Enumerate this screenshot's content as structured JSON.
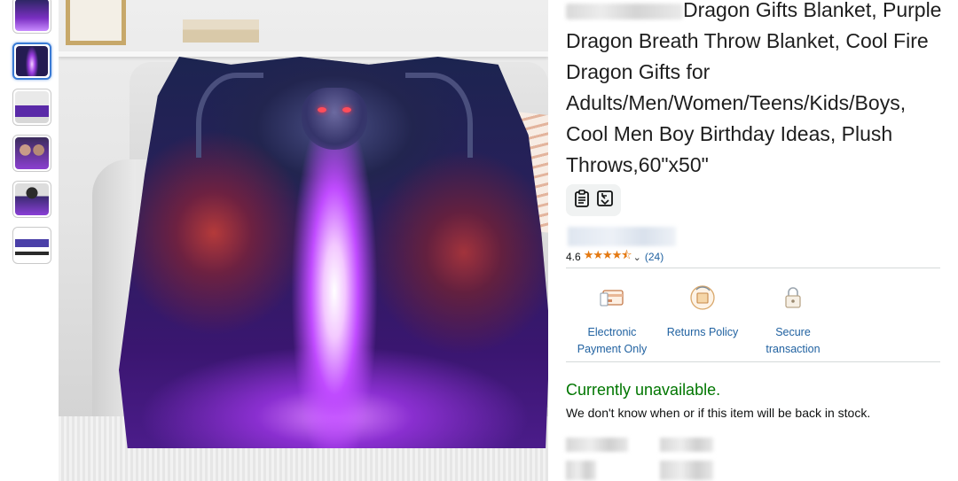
{
  "product": {
    "title": "Dragon Gifts Blanket, Purple Dragon Breath Throw Blanket, Cool Fire Dragon Gifts for Adults/Men/Women/Teens/Kids/Boys, Cool Men Boy Birthday Ideas, Plush Throws,60\"x50\"",
    "rating": "4.6",
    "stars_display": "★★★★⯪",
    "rating_count": "(24)"
  },
  "features": [
    {
      "icon": "card-payment-icon",
      "label": "Electronic Payment Only"
    },
    {
      "icon": "returns-box-icon",
      "label": "Returns Policy"
    },
    {
      "icon": "lock-icon",
      "label": "Secure transaction"
    }
  ],
  "availability": {
    "status": "Currently unavailable.",
    "note": "We don't know when or if this item will be back in stock."
  },
  "thumbnails": [
    {
      "name": "thumb-1"
    },
    {
      "name": "thumb-2",
      "selected": true
    },
    {
      "name": "thumb-3"
    },
    {
      "name": "thumb-4"
    },
    {
      "name": "thumb-5"
    },
    {
      "name": "thumb-6"
    }
  ],
  "colors": {
    "link": "#2162a1",
    "availability_green": "#007600",
    "star_orange": "#e47911",
    "selected_thumb": "#3a7bd5"
  }
}
